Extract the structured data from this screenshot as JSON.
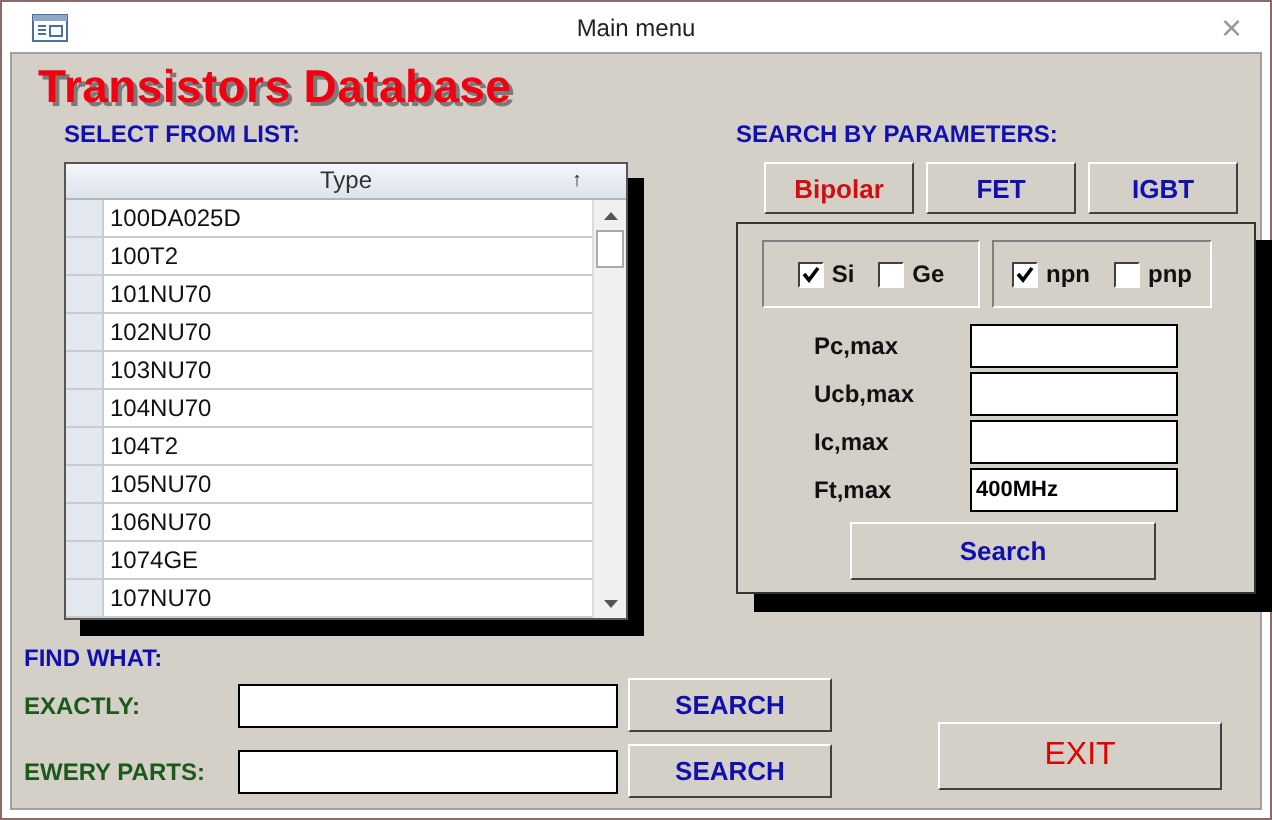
{
  "window": {
    "title": "Main menu",
    "close": "×"
  },
  "app_title": "Transistors Database",
  "list": {
    "label": "SELECT FROM LIST:",
    "column": "Type",
    "sort": "↑",
    "rows": [
      "100DA025D",
      "100T2",
      "101NU70",
      "102NU70",
      "103NU70",
      "104NU70",
      "104T2",
      "105NU70",
      "106NU70",
      "1074GE",
      "107NU70"
    ]
  },
  "search": {
    "label": "SEARCH BY PARAMETERS:",
    "tabs": [
      {
        "label": "Bipolar",
        "selected": true
      },
      {
        "label": "FET",
        "selected": false
      },
      {
        "label": "IGBT",
        "selected": false
      }
    ],
    "groups": [
      [
        {
          "label": "Si",
          "checked": true
        },
        {
          "label": "Ge",
          "checked": false
        }
      ],
      [
        {
          "label": "npn",
          "checked": true
        },
        {
          "label": "pnp",
          "checked": false
        }
      ]
    ],
    "fields": [
      {
        "label": "Pc,max"
      },
      {
        "label": "Ucb,max"
      },
      {
        "label": "Ic,max"
      },
      {
        "label": "Ft,max",
        "value": "400MHz"
      }
    ],
    "button": "Search"
  },
  "find": {
    "label": "FIND WHAT:",
    "rows": [
      {
        "label": "EXACTLY:",
        "button": "SEARCH"
      },
      {
        "label": "EWERY PARTS:",
        "button": "SEARCH"
      }
    ]
  },
  "exit": "EXIT"
}
